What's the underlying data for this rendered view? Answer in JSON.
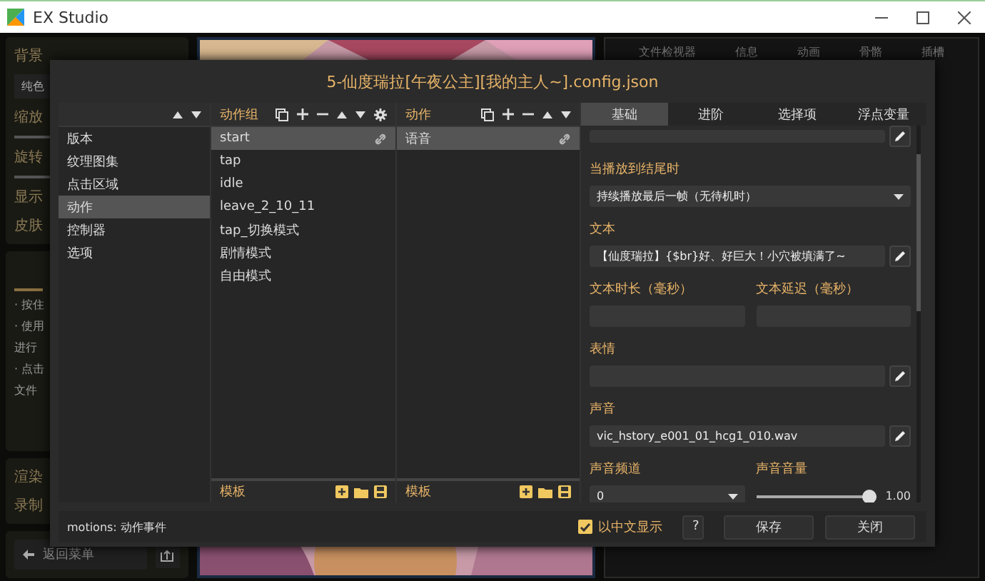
{
  "window": {
    "title": "EX Studio"
  },
  "background": {
    "left_panel": [
      {
        "label": "背景",
        "value": "纯色"
      },
      {
        "label": "缩放",
        "slider": true
      },
      {
        "label": "旋转",
        "slider": true
      },
      {
        "label": "显示"
      },
      {
        "label": "皮肤"
      }
    ],
    "tips": [
      "· 按住",
      "· 使用",
      "进行",
      "· 点击",
      "文件"
    ],
    "render_labels": [
      "渲染",
      "录制"
    ],
    "back_button": "返回菜单",
    "picture": {
      "kind": "picture"
    },
    "right_tabs": [
      "文件检视器",
      "信息",
      "动画",
      "骨骼",
      "插槽"
    ]
  },
  "dialog": {
    "title": "5-仙度瑞拉[午夜公主][我的主人~].config.json",
    "categories": [
      {
        "label": "版本",
        "selected": false
      },
      {
        "label": "纹理图集",
        "selected": false
      },
      {
        "label": "点击区域",
        "selected": false
      },
      {
        "label": "动作",
        "selected": true
      },
      {
        "label": "控制器",
        "selected": false
      },
      {
        "label": "选项",
        "selected": false
      }
    ],
    "motion_groups": {
      "header": "动作组",
      "footer": "模板",
      "items": [
        {
          "label": "start",
          "selected": true,
          "linked": true
        },
        {
          "label": "tap",
          "selected": false,
          "linked": false
        },
        {
          "label": "idle",
          "selected": false,
          "linked": false
        },
        {
          "label": "leave_2_10_11",
          "selected": false,
          "linked": false
        },
        {
          "label": "tap_切换模式",
          "selected": false,
          "linked": false
        },
        {
          "label": "剧情模式",
          "selected": false,
          "linked": false
        },
        {
          "label": "自由模式",
          "selected": false,
          "linked": false
        }
      ]
    },
    "motions": {
      "header": "动作",
      "footer": "模板",
      "items": [
        {
          "label": "语音",
          "selected": true,
          "linked": true
        }
      ]
    },
    "tabs": [
      {
        "label": "基础",
        "selected": true
      },
      {
        "label": "进阶",
        "selected": false
      },
      {
        "label": "选择项",
        "selected": false
      },
      {
        "label": "浮点变量",
        "selected": false
      }
    ],
    "form": [
      {
        "kind": "text",
        "editable": true
      },
      {
        "kind": "select",
        "label": "当播放到结尾时",
        "value": "持续播放最后一帧（无待机时）"
      },
      {
        "kind": "text",
        "label": "文本",
        "value": "【仙度瑞拉】{$br}好、好巨大！小穴被填满了~",
        "editable": true
      },
      {
        "kind": "pair",
        "fields": [
          {
            "kind": "text",
            "label": "文本时长（毫秒）"
          },
          {
            "kind": "text",
            "label": "文本延迟（毫秒）"
          }
        ]
      },
      {
        "kind": "text",
        "label": "表情",
        "editable": true
      },
      {
        "kind": "text",
        "label": "声音",
        "value": "vic_hstory_e001_01_hcg1_010.wav",
        "editable": true
      },
      {
        "kind": "pair",
        "fields": [
          {
            "kind": "select",
            "label": "声音频道",
            "value": "0"
          },
          {
            "kind": "slider",
            "label": "声音音量",
            "level": 1.0,
            "reading": "1.00"
          }
        ]
      }
    ],
    "status": "motions: 动作事件",
    "chinese_display": {
      "label": "以中文显示",
      "checked": true
    },
    "buttons": [
      {
        "kind": "help",
        "label": "?"
      },
      {
        "kind": "normal",
        "label": "保存"
      },
      {
        "kind": "normal",
        "label": "关闭"
      }
    ]
  }
}
